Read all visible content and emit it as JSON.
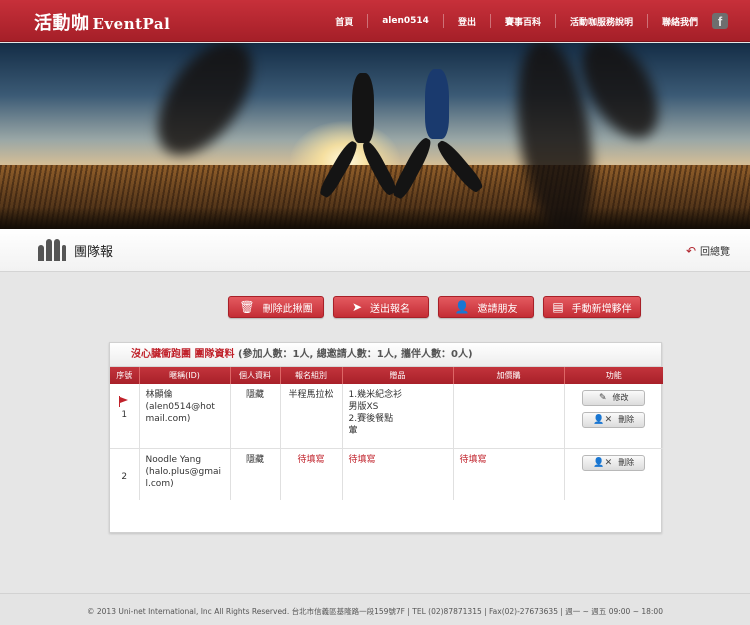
{
  "header": {
    "logo_cn": "活動咖",
    "logo_en": "EventPal",
    "nav": [
      "首頁",
      "alen0514",
      "登出",
      "賽事百科",
      "活動咖服務說明",
      "聯絡我們"
    ],
    "fb_icon_glyph": "f"
  },
  "page": {
    "title": "團隊報",
    "back_label": "回總覽"
  },
  "actions": {
    "delete_team": "刪除此揪團",
    "submit": "送出報名",
    "invite": "邀請朋友",
    "add_manual": "手動新增夥伴"
  },
  "panel": {
    "team_name": "沒心臟衝跑團 團隊資料",
    "stats": "(參加人數：1人, 總邀請人數：1人, 攜伴人數：0人)",
    "columns": [
      "序號",
      "暱稱(ID)",
      "個人資料",
      "報名組別",
      "贈品",
      "加價購",
      "功能"
    ],
    "rows": [
      {
        "no": "1",
        "name": "林顯倫",
        "id": "(alen0514@hotmail.com)",
        "profile": "隱藏",
        "group": "半程馬拉松",
        "gift": [
          "1.幾米紀念衫",
          "男版XS",
          "2.賽後餐點",
          "葷"
        ],
        "addon": "",
        "edit_label": "修改",
        "delete_label": "刪除"
      },
      {
        "no": "2",
        "name": "Noodle Yang",
        "id": "(halo.plus@gmail.com)",
        "profile": "隱藏",
        "group": "待填寫",
        "gift": [
          "待填寫"
        ],
        "addon": "待填寫",
        "delete_label": "刪除"
      }
    ]
  },
  "footer": {
    "text": "© 2013 Uni-net International, Inc All Rights Reserved. 台北市信義區基隆路一段159號7F | TEL (02)87871315 | Fax(02)-27673635 | 週一 ~ 週五 09:00 ~ 18:00"
  },
  "colors": {
    "brand_red": "#b0242d",
    "header_red": "#c7303a",
    "background": "#e6e6e6"
  }
}
